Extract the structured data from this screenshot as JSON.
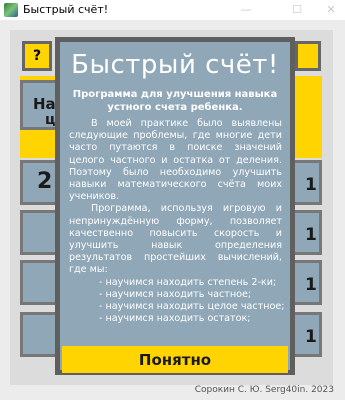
{
  "window": {
    "title": "Быстрый счёт!",
    "minimize_glyph": "—",
    "maximize_glyph": "☐",
    "close_glyph": "✕"
  },
  "background": {
    "help_label": "?",
    "header_fragment": "На",
    "header_fragment2": "ц",
    "left_number": "2",
    "right_numbers": [
      "1",
      "1",
      "1",
      "1"
    ]
  },
  "dialog": {
    "title": "Быстрый счёт!",
    "subtitle": "Программа для улучшения навыка устного счета ребенка.",
    "paragraph1": "В моей практике было выявлены следующие проблемы, где многие дети часто путаются в поиске значений целого частного и остатка от деления. Поэтому было необходимо улучшить навыки математического счёта моих учеников.",
    "paragraph2": "Программа, используя игровую и непринуждённую форму, позволяет качественно повысить скорость и улучшить навык определения результатов простейших вычислений, где мы:",
    "goals": [
      "научимся находить степень 2-ки;",
      "научимся находить частное;",
      "научимся находить целое частное;",
      "научимся находить остаток;"
    ],
    "ok_label": "Понятно"
  },
  "footer": {
    "credit": "Сорокин С. Ю. Serg40in. 2023"
  },
  "colors": {
    "dialog_bg": "#8fa7b7",
    "dialog_border": "#5f5f5f",
    "accent_yellow": "#ffd400",
    "panel_bg": "#dcdcdc"
  }
}
